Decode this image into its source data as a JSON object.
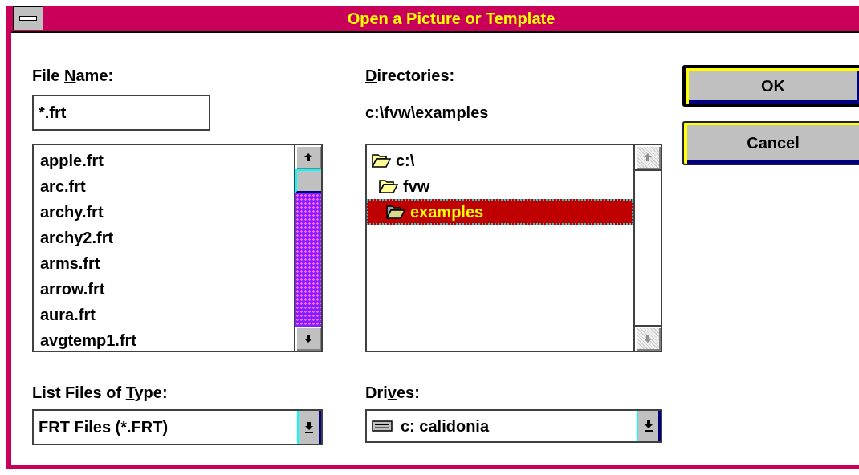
{
  "window": {
    "title": "Open a Picture or Template"
  },
  "file_name": {
    "label": {
      "before": "File ",
      "key": "N",
      "after": "ame:"
    },
    "value": "*.frt"
  },
  "files": {
    "items": [
      {
        "label": "apple.frt",
        "selected": false
      },
      {
        "label": "arc.frt",
        "selected": false
      },
      {
        "label": "archy.frt",
        "selected": false
      },
      {
        "label": "archy2.frt",
        "selected": false
      },
      {
        "label": "arms.frt",
        "selected": false
      },
      {
        "label": "arrow.frt",
        "selected": false
      },
      {
        "label": "aura.frt",
        "selected": false
      },
      {
        "label": "avgtemp1.frt",
        "selected": false
      }
    ]
  },
  "directories": {
    "label": {
      "key": "D",
      "after": "irectories:"
    },
    "path": "c:\\fvw\\examples",
    "items": [
      {
        "label": "c:\\",
        "selected": false,
        "children": [
          {
            "label": "fvw",
            "selected": false,
            "children": [
              {
                "label": "examples",
                "selected": true
              }
            ]
          }
        ]
      }
    ]
  },
  "file_type": {
    "label": {
      "before": "List Files of ",
      "key": "T",
      "after": "ype:"
    },
    "value": "FRT Files (*.FRT)"
  },
  "drives": {
    "label": {
      "before": "Dri",
      "key": "v",
      "after": "es:"
    },
    "value": "c: calidonia"
  },
  "buttons": [
    {
      "label": "OK",
      "default": true
    },
    {
      "label": "Cancel",
      "default": false
    }
  ]
}
